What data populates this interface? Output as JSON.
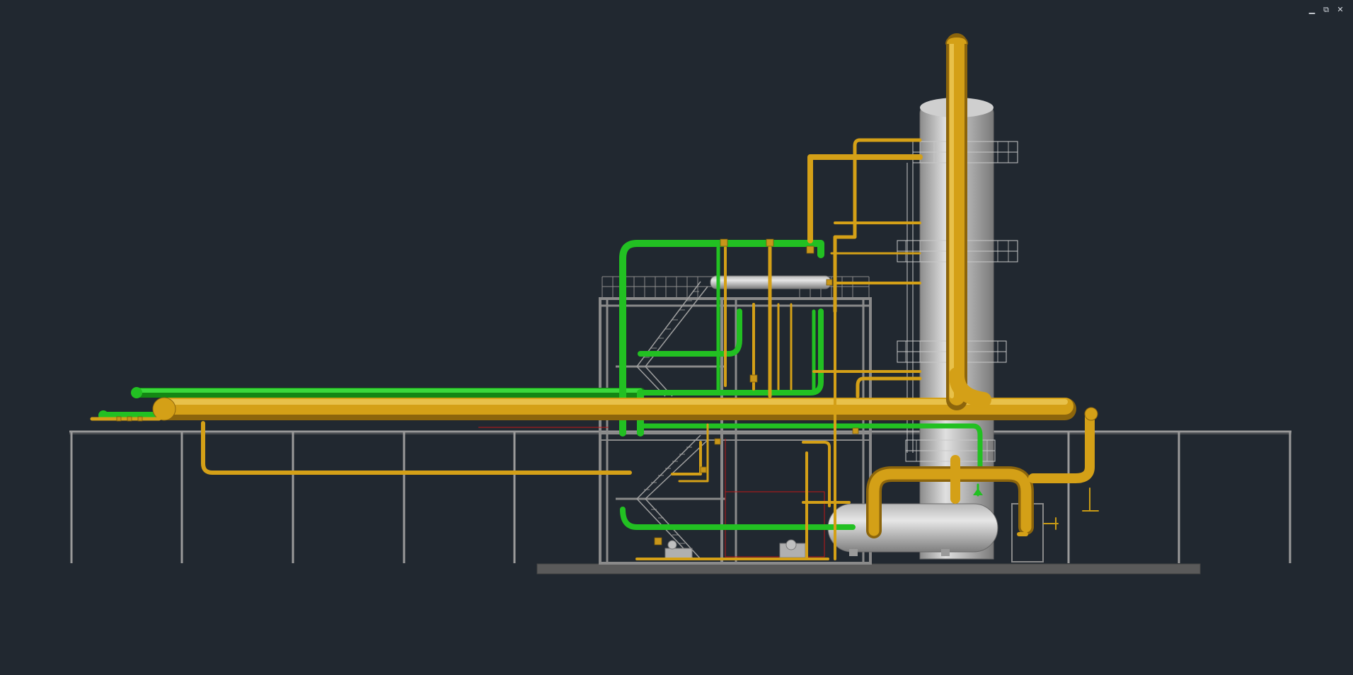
{
  "window": {
    "controls": [
      {
        "name": "minimize",
        "glyph": "▁"
      },
      {
        "name": "restore",
        "glyph": "⧉"
      },
      {
        "name": "close",
        "glyph": "✕"
      }
    ]
  },
  "viewport": {
    "background": "#212830",
    "model": "piping-plant-3d-view"
  },
  "colors": {
    "steel": "#9a9a9a",
    "steel_dark": "#6e6e6e",
    "yellow_pipe": "#d4a017",
    "yellow_pipe_dark": "#9c7410",
    "green_pipe": "#22c022",
    "green_pipe_dark": "#148614",
    "vessel_light": "#d6d6d6",
    "vessel_dark": "#8c8c8c",
    "red_line": "#c01818"
  }
}
